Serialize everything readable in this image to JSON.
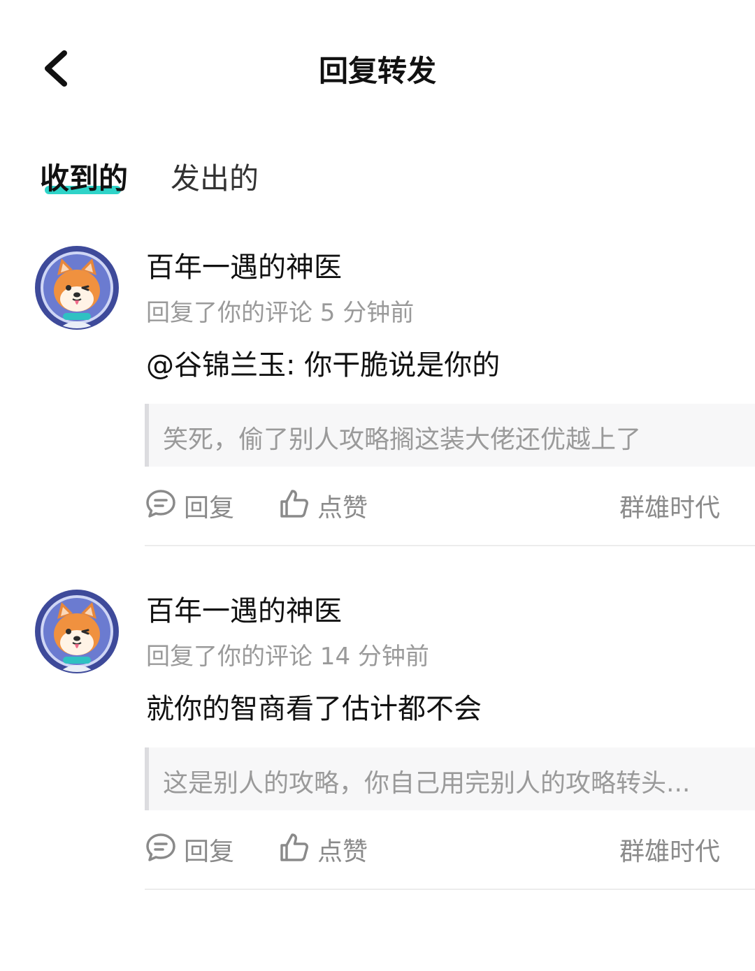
{
  "header": {
    "title": "回复转发",
    "back_icon": "chevron-left-icon"
  },
  "tabs": [
    {
      "label": "收到的",
      "active": true
    },
    {
      "label": "发出的",
      "active": false
    }
  ],
  "colors": {
    "accent": "#2fd3c8",
    "secondary_text": "#9a9a9a",
    "quote_bg": "#f7f7f8"
  },
  "replies": [
    {
      "username": "百年一遇的神医",
      "meta": "回复了你的评论 5 分钟前",
      "comment": "@谷锦兰玉: 你干脆说是你的",
      "quote": "笑死，偷了别人攻略搁这装大佬还优越上了",
      "reply_label": "回复",
      "like_label": "点赞",
      "source": "群雄时代",
      "avatar_icon": "shiba-dog-avatar"
    },
    {
      "username": "百年一遇的神医",
      "meta": "回复了你的评论 14 分钟前",
      "comment": "就你的智商看了估计都不会",
      "quote": "这是别人的攻略，你自己用完别人的攻略转头...",
      "reply_label": "回复",
      "like_label": "点赞",
      "source": "群雄时代",
      "avatar_icon": "shiba-dog-avatar"
    }
  ]
}
